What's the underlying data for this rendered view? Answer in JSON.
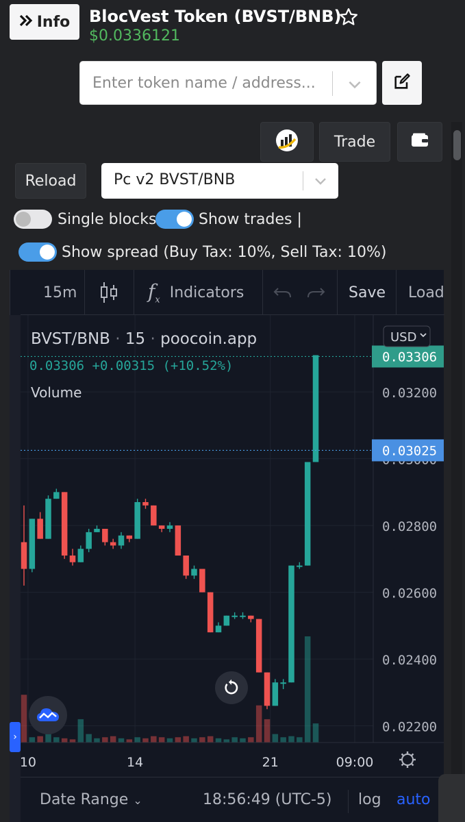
{
  "header": {
    "info_label": "Info",
    "token_title": "BlocVest Token (BVST/BNB)",
    "price": "$0.0336121"
  },
  "search": {
    "placeholder": "Enter token name / address..."
  },
  "toolbar": {
    "trade_label": "Trade",
    "reload_label": "Reload"
  },
  "pair_select": {
    "value": "Pc v2 BVST/BNB"
  },
  "toggles": {
    "single_blocks": {
      "label": "Single blocks",
      "on": false
    },
    "show_trades": {
      "label": "Show trades |",
      "on": true
    },
    "show_spread": {
      "label": "Show spread (Buy Tax: 10%, Sell Tax: 10%)",
      "on": true
    }
  },
  "tv_toolbar": {
    "interval": "15m",
    "indicators": "Indicators",
    "save": "Save",
    "load": "Load"
  },
  "chart_header": {
    "symbol": "BVST/BNB",
    "interval": "15",
    "source": "poocoin.app",
    "currency": "USD",
    "ohlc_line": "0.03306  +0.00315 (+10.52%)",
    "volume_label": "Volume"
  },
  "colors": {
    "up": "#26a69a",
    "down": "#ef5350",
    "price_green": "#52b95f",
    "accent_blue": "#4a9de8",
    "last_price_tag": "#2f9c8a",
    "spread_tag": "#4a90e2"
  },
  "chart_data": {
    "type": "candlestick",
    "x_tick_labels": [
      "10",
      "14",
      "21",
      "09:00"
    ],
    "y_tick_labels": [
      "0.03200",
      "0.03000",
      "0.02800",
      "0.02600",
      "0.02400",
      "0.02200"
    ],
    "ylim": [
      0.0215,
      0.0343
    ],
    "last_price": "0.03306",
    "spread_price": "0.03025",
    "candles": [
      {
        "o": 0.0275,
        "h": 0.0286,
        "l": 0.0262,
        "c": 0.0267
      },
      {
        "o": 0.0267,
        "h": 0.0282,
        "l": 0.0266,
        "c": 0.0282
      },
      {
        "o": 0.0282,
        "h": 0.0284,
        "l": 0.0276,
        "c": 0.0276
      },
      {
        "o": 0.0276,
        "h": 0.0289,
        "l": 0.0276,
        "c": 0.0288
      },
      {
        "o": 0.0288,
        "h": 0.0291,
        "l": 0.0288,
        "c": 0.029
      },
      {
        "o": 0.029,
        "h": 0.029,
        "l": 0.027,
        "c": 0.0271
      },
      {
        "o": 0.0271,
        "h": 0.0273,
        "l": 0.0268,
        "c": 0.0269
      },
      {
        "o": 0.0269,
        "h": 0.0274,
        "l": 0.0269,
        "c": 0.0273
      },
      {
        "o": 0.0273,
        "h": 0.0279,
        "l": 0.0272,
        "c": 0.0278
      },
      {
        "o": 0.0278,
        "h": 0.028,
        "l": 0.0278,
        "c": 0.0279
      },
      {
        "o": 0.0279,
        "h": 0.0279,
        "l": 0.0274,
        "c": 0.0275
      },
      {
        "o": 0.0275,
        "h": 0.0276,
        "l": 0.0273,
        "c": 0.0274
      },
      {
        "o": 0.0274,
        "h": 0.0278,
        "l": 0.0273,
        "c": 0.0277
      },
      {
        "o": 0.0277,
        "h": 0.0277,
        "l": 0.0275,
        "c": 0.0276
      },
      {
        "o": 0.0276,
        "h": 0.0288,
        "l": 0.0276,
        "c": 0.0287
      },
      {
        "o": 0.0287,
        "h": 0.0288,
        "l": 0.0285,
        "c": 0.0286
      },
      {
        "o": 0.0286,
        "h": 0.0286,
        "l": 0.028,
        "c": 0.028
      },
      {
        "o": 0.028,
        "h": 0.028,
        "l": 0.0278,
        "c": 0.0279
      },
      {
        "o": 0.0279,
        "h": 0.0281,
        "l": 0.0278,
        "c": 0.028
      },
      {
        "o": 0.028,
        "h": 0.028,
        "l": 0.0271,
        "c": 0.0271
      },
      {
        "o": 0.0271,
        "h": 0.0271,
        "l": 0.0264,
        "c": 0.0265
      },
      {
        "o": 0.0265,
        "h": 0.0268,
        "l": 0.0264,
        "c": 0.0267
      },
      {
        "o": 0.0267,
        "h": 0.0267,
        "l": 0.026,
        "c": 0.026
      },
      {
        "o": 0.026,
        "h": 0.026,
        "l": 0.0248,
        "c": 0.0248
      },
      {
        "o": 0.0248,
        "h": 0.0251,
        "l": 0.0248,
        "c": 0.025
      },
      {
        "o": 0.025,
        "h": 0.0253,
        "l": 0.025,
        "c": 0.0253
      },
      {
        "o": 0.0253,
        "h": 0.0254,
        "l": 0.0252,
        "c": 0.0253
      },
      {
        "o": 0.0253,
        "h": 0.0254,
        "l": 0.0252,
        "c": 0.0253
      },
      {
        "o": 0.0253,
        "h": 0.0253,
        "l": 0.0251,
        "c": 0.0252
      },
      {
        "o": 0.0252,
        "h": 0.0252,
        "l": 0.0236,
        "c": 0.0236
      },
      {
        "o": 0.0236,
        "h": 0.0236,
        "l": 0.0225,
        "c": 0.0226
      },
      {
        "o": 0.0226,
        "h": 0.0234,
        "l": 0.0226,
        "c": 0.0233
      },
      {
        "o": 0.0233,
        "h": 0.0234,
        "l": 0.0231,
        "c": 0.0233
      },
      {
        "o": 0.0233,
        "h": 0.0268,
        "l": 0.0233,
        "c": 0.0268
      },
      {
        "o": 0.0268,
        "h": 0.0269,
        "l": 0.0267,
        "c": 0.0268
      },
      {
        "o": 0.0268,
        "h": 0.0299,
        "l": 0.0268,
        "c": 0.0299
      },
      {
        "o": 0.0299,
        "h": 0.0331,
        "l": 0.0299,
        "c": 0.0331
      }
    ],
    "volumes": [
      0.45,
      0.05,
      0.06,
      0.08,
      0.05,
      0.04,
      0.03,
      0.22,
      0.08,
      0.04,
      0.05,
      0.06,
      0.04,
      0.03,
      0.05,
      0.04,
      0.06,
      0.05,
      0.04,
      0.05,
      0.06,
      0.04,
      0.05,
      0.06,
      0.04,
      0.03,
      0.05,
      0.04,
      0.05,
      0.35,
      0.22,
      0.08,
      0.05,
      0.06,
      0.05,
      1.0,
      0.18
    ]
  },
  "bottom_bar": {
    "date_range": "Date Range",
    "time": "18:56:49 (UTC-5)",
    "log": "log",
    "auto": "auto"
  }
}
